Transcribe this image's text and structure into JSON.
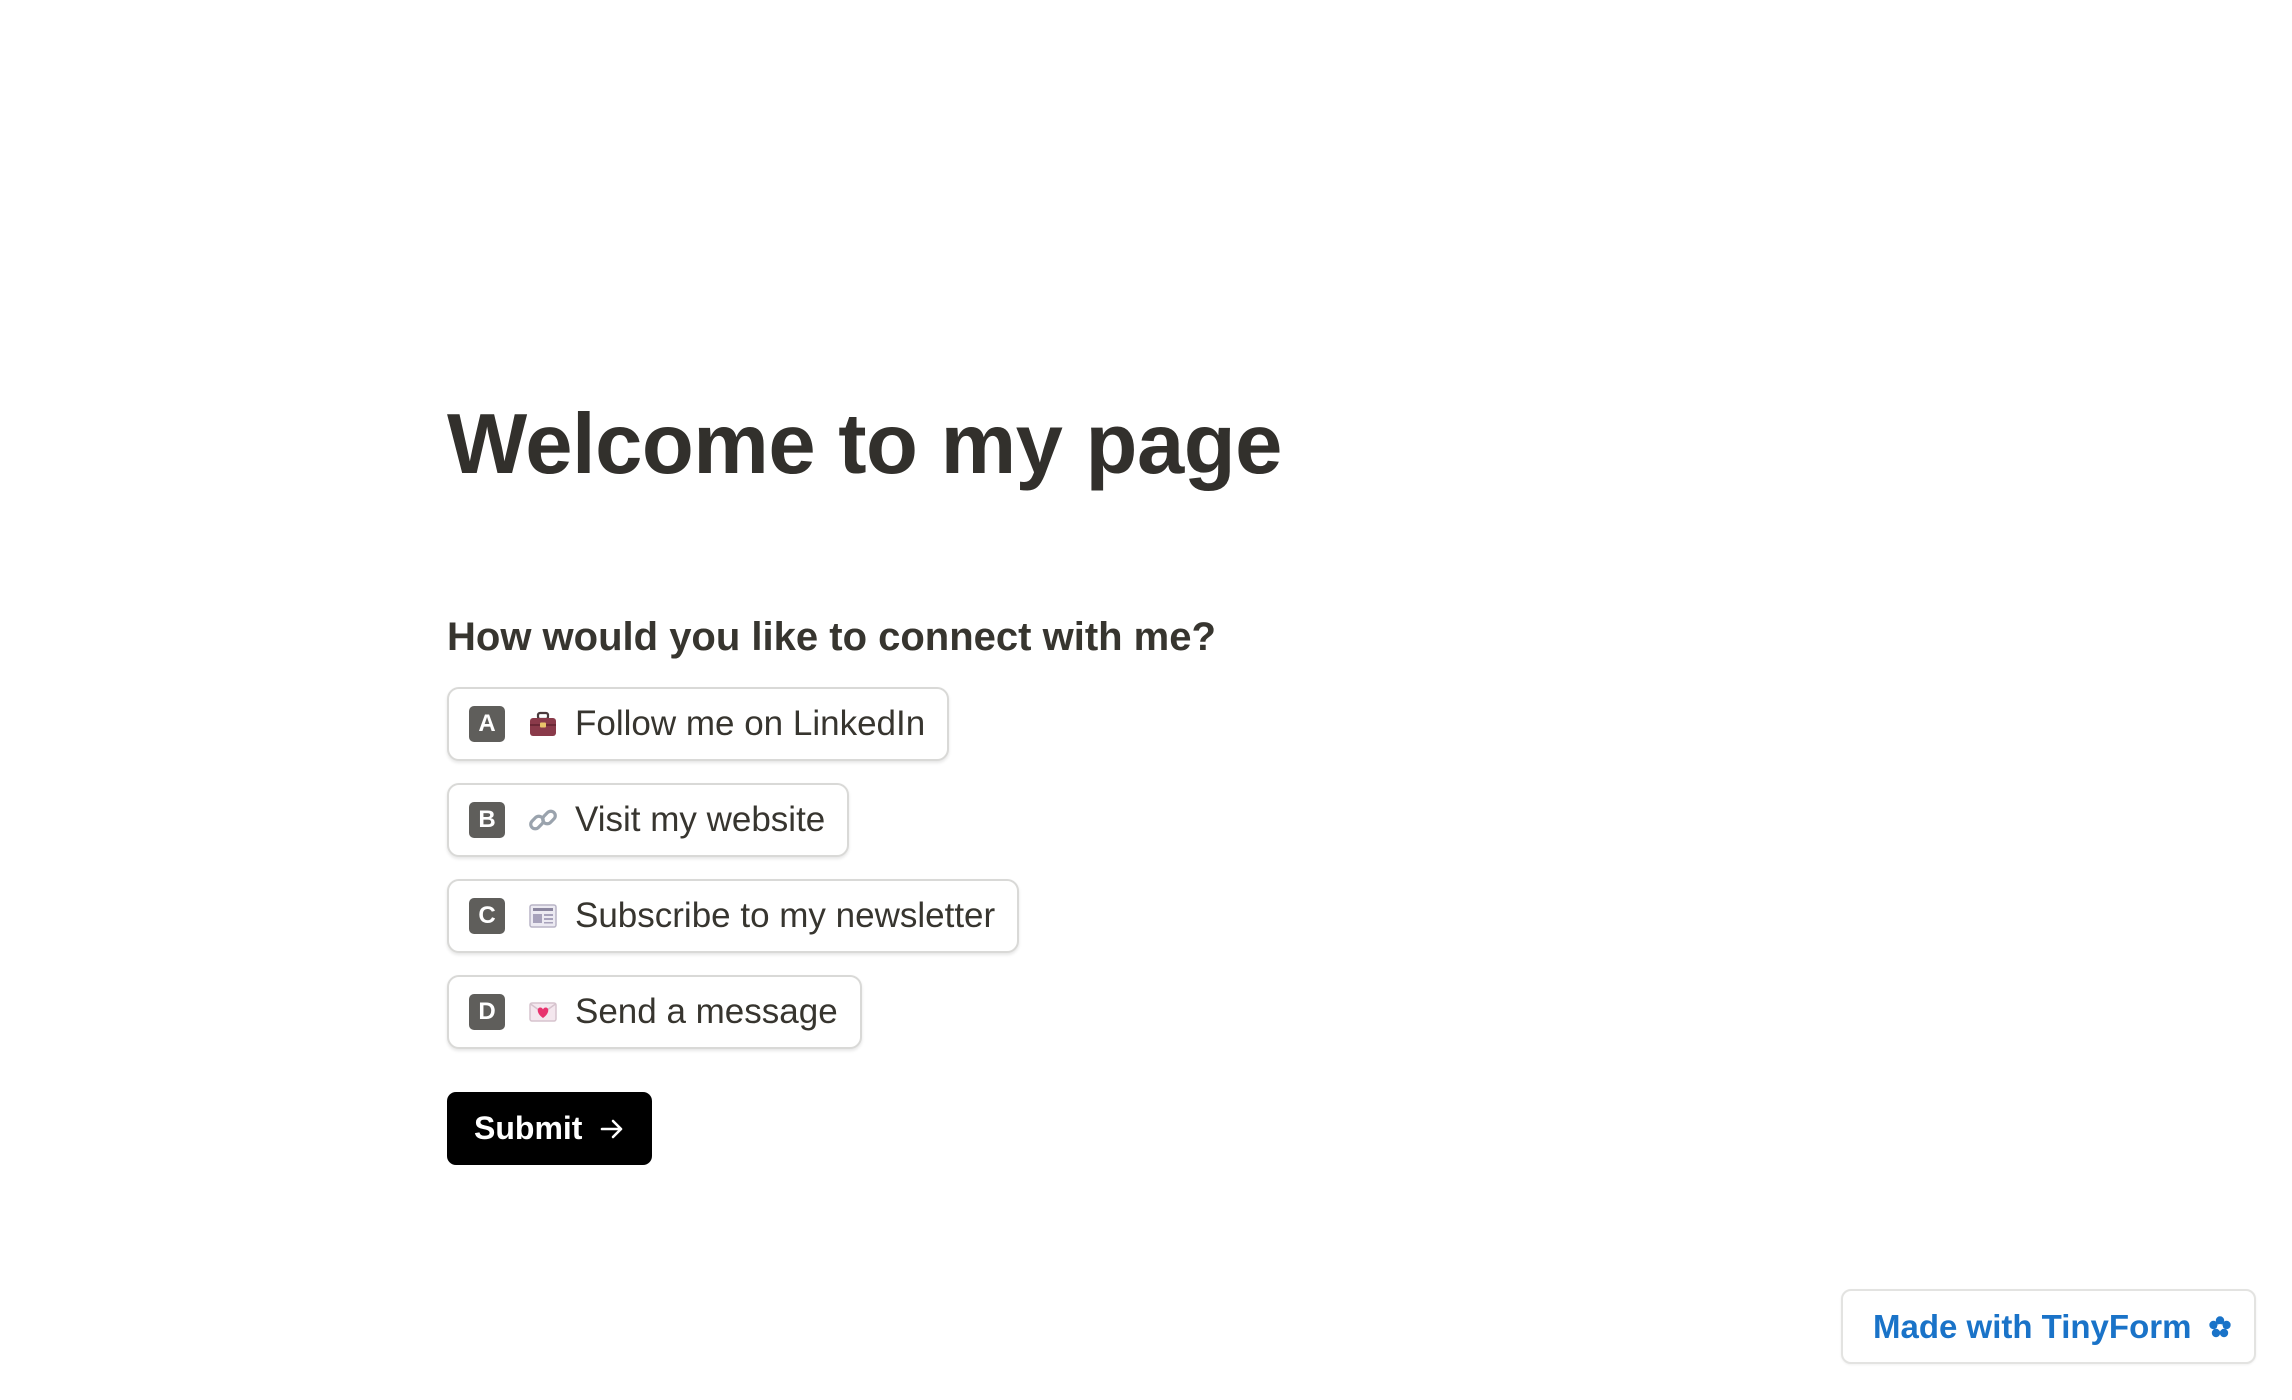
{
  "page": {
    "title": "Welcome to my page"
  },
  "form": {
    "question": "How would you like to connect with me?",
    "options": [
      {
        "key": "A",
        "icon": "briefcase-icon",
        "label": "Follow me on LinkedIn"
      },
      {
        "key": "B",
        "icon": "link-icon",
        "label": "Visit my website"
      },
      {
        "key": "C",
        "icon": "newspaper-icon",
        "label": "Subscribe to my newsletter"
      },
      {
        "key": "D",
        "icon": "love-letter-icon",
        "label": "Send a message"
      }
    ],
    "submit_label": "Submit"
  },
  "footer": {
    "badge_label": "Made with TinyForm",
    "badge_icon": "tinyform-flower-icon"
  },
  "colors": {
    "text": "#37352f",
    "key_badge": "#5f5e5b",
    "submit_bg": "#000000",
    "brand_blue": "#1a73c8"
  }
}
